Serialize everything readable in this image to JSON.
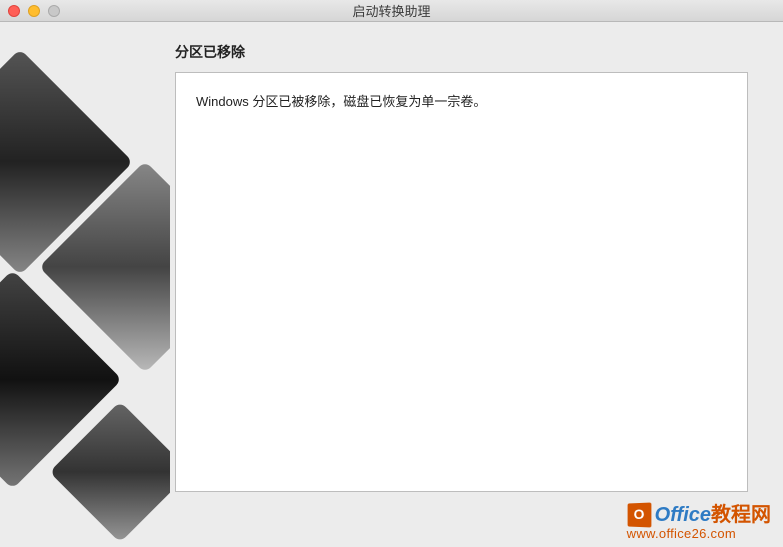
{
  "window": {
    "title": "启动转换助理"
  },
  "content": {
    "heading": "分区已移除",
    "message": "Windows 分区已被移除，磁盘已恢复为单一宗卷。"
  },
  "watermark": {
    "brand_prefix": "Office",
    "brand_suffix": "教程网",
    "url": "www.office26.com",
    "cube_letter": "O"
  }
}
